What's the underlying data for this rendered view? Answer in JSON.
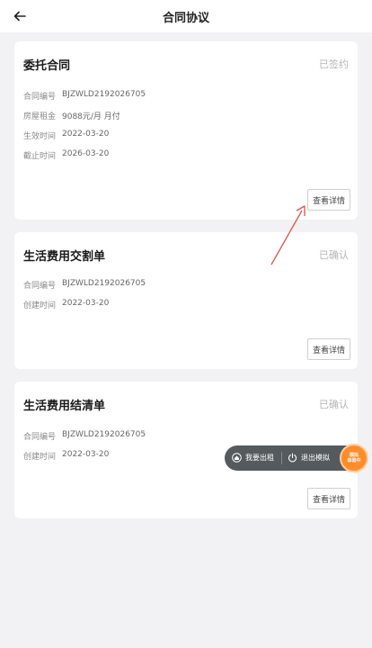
{
  "header": {
    "title": "合同协议",
    "back_icon": "arrow-left-icon"
  },
  "cards": [
    {
      "title": "委托合同",
      "status": "已签约",
      "rows": [
        {
          "label": "合同编号",
          "value": "BJZWLD2192026705"
        },
        {
          "label": "房屋租金",
          "value": "9088元/月 月付"
        },
        {
          "label": "生效时间",
          "value": "2022-03-20"
        },
        {
          "label": "截止时间",
          "value": "2026-03-20"
        }
      ],
      "button": "查看详情"
    },
    {
      "title": "生活费用交割单",
      "status": "已确认",
      "rows": [
        {
          "label": "合同编号",
          "value": "BJZWLD2192026705"
        },
        {
          "label": "创建时间",
          "value": "2022-03-20"
        }
      ],
      "button": "查看详情"
    },
    {
      "title": "生活费用结清单",
      "status": "已确认",
      "rows": [
        {
          "label": "合同编号",
          "value": "BJZWLD2192026705"
        },
        {
          "label": "创建时间",
          "value": "2022-03-20"
        }
      ],
      "button": "查看详情"
    }
  ],
  "floating": {
    "rent_label": "我要出租",
    "exit_label": "退出模拟",
    "badge": "模拟\n体验中"
  },
  "colors": {
    "annotation_arrow": "#e0524a",
    "badge": "#ff8c2a"
  }
}
